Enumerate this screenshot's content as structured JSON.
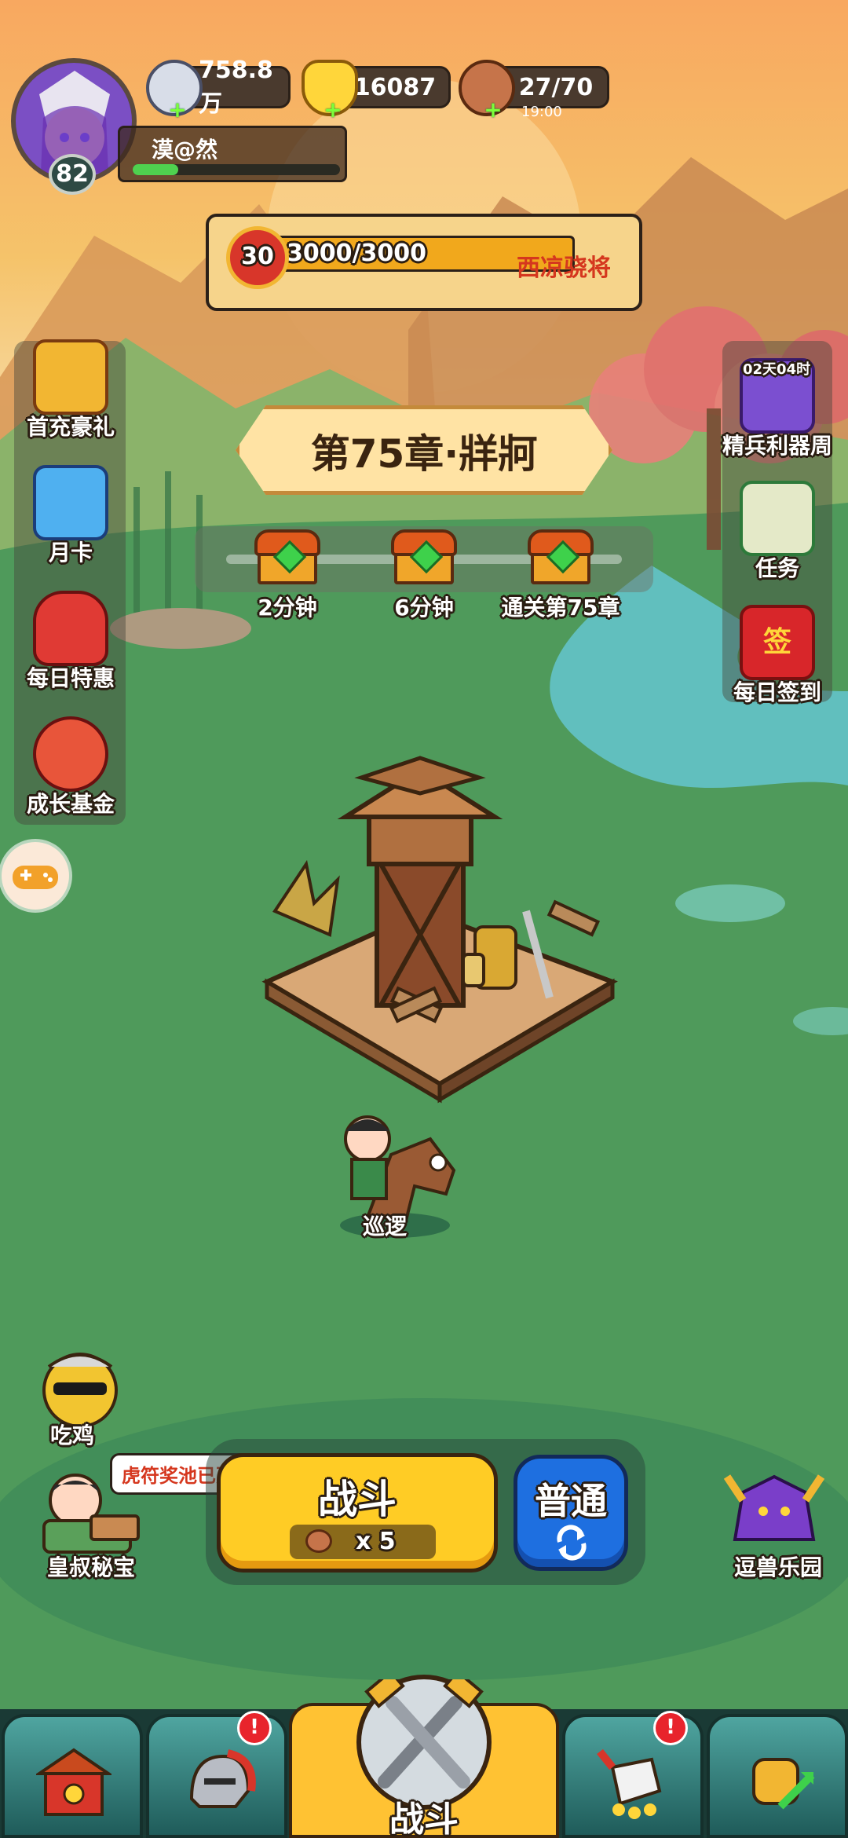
{
  "player": {
    "level": "82",
    "name": "漠@然",
    "exp_progress": 0.22
  },
  "resources": {
    "silver": "758.8万",
    "gold": "16087",
    "stamina": "27/70",
    "stamina_timer": "19:00"
  },
  "rank": {
    "level": "30",
    "progress_text": "3000/3000",
    "progress": 1.0,
    "title": "西凉骁将"
  },
  "chapter": {
    "title": "第75章·牂牁"
  },
  "chests": [
    {
      "label": "2分钟",
      "icon": "treasure-chest-icon"
    },
    {
      "label": "6分钟",
      "icon": "treasure-chest-icon"
    },
    {
      "label": "通关第75章",
      "icon": "treasure-chest-icon"
    }
  ],
  "left_menu": [
    {
      "label": "首充豪礼",
      "icon": "golden-chest-icon"
    },
    {
      "label": "月卡",
      "icon": "calendar-card-icon"
    },
    {
      "label": "每日特惠",
      "icon": "gift-bag-icon"
    },
    {
      "label": "成长基金",
      "icon": "fortune-god-icon"
    }
  ],
  "right_menu": [
    {
      "label": "精兵利器周",
      "icon": "weapon-chest-icon",
      "timer": "02天04时"
    },
    {
      "label": "任务",
      "icon": "scroll-icon"
    },
    {
      "label": "每日签到",
      "icon": "sign-in-icon",
      "badge_text": "签"
    }
  ],
  "game_button": {
    "icon": "gamepad-icon"
  },
  "scene": {
    "patrol_label": "巡逻"
  },
  "bottom_left": [
    {
      "label": "吃鸡",
      "icon": "chicken-character-icon"
    },
    {
      "label": "皇叔秘宝",
      "icon": "reading-character-icon",
      "bubble": "虎符奖池已更新"
    }
  ],
  "bottom_right": {
    "label": "逗兽乐园",
    "icon": "beast-park-icon"
  },
  "battle": {
    "label": "战斗",
    "cost": "x 5",
    "mode_label": "普通"
  },
  "nav": [
    {
      "name": "city",
      "icon": "city-gate-icon",
      "badge": false
    },
    {
      "name": "hero",
      "icon": "helmet-icon",
      "badge": true,
      "badge_text": "!"
    },
    {
      "name": "battle",
      "icon": "crossed-swords-icon",
      "label": "战斗",
      "active": true
    },
    {
      "name": "equipment",
      "icon": "horn-star-icon",
      "badge": true,
      "badge_text": "!"
    },
    {
      "name": "upgrade",
      "icon": "fist-upgrade-icon",
      "badge": false
    }
  ],
  "colors": {
    "battle_button": "#ffcc25",
    "mode_button": "#1e6fe0",
    "nav_active": "#ffc233",
    "nav_inactive": "#2b7a78"
  }
}
